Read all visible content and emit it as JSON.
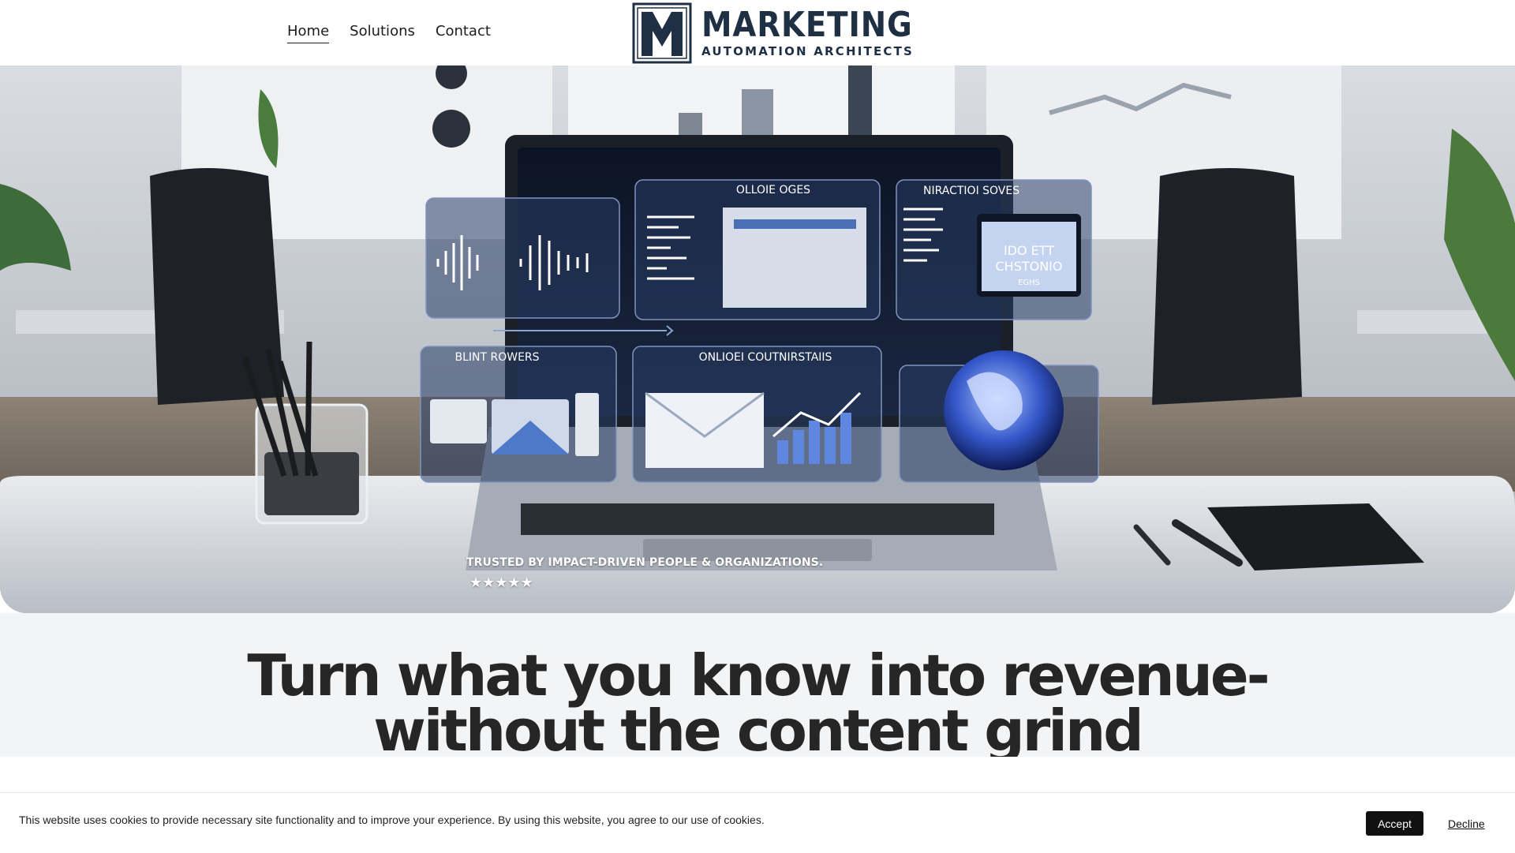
{
  "nav": {
    "items": [
      {
        "label": "Home",
        "active": true
      },
      {
        "label": "Solutions",
        "active": false
      },
      {
        "label": "Contact",
        "active": false
      }
    ]
  },
  "logo": {
    "title": "MARKETING",
    "subtitle": "AUTOMATION ARCHITECTS",
    "color": "#1f2f44"
  },
  "hero": {
    "image_subject": "laptop with floating marketing dashboard panels on an office desk",
    "panel_labels": [
      "OLLOIE OGES",
      "NIRACTIOI SOVES",
      "BLINT ROWERS",
      "ONLIOEI COUTNIRSTAIIS"
    ],
    "screen_text": [
      "IDO ETT",
      "CHSTONIO",
      "EGHS"
    ],
    "trusted_text": "TRUSTED BY IMPACT-DRIVEN PEOPLE & ORGANIZATIONS.",
    "stars": "★★★★★",
    "rating": 5
  },
  "headline": {
    "line1": "Turn what you know into revenue-",
    "line2": "without the content grind"
  },
  "cookie": {
    "text": "This website uses cookies to provide necessary site functionality and to improve your experience. By using this website, you agree to our use of cookies.",
    "accept_label": "Accept",
    "decline_label": "Decline"
  }
}
